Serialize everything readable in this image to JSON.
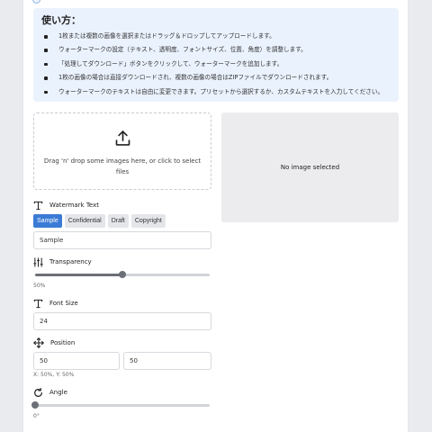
{
  "instructions": {
    "title": "使い方：",
    "items": [
      "1枚または複数の画像を選択またはドラッグ＆ドロップしてアップロードします。",
      "ウォーターマークの設定（テキスト、透明度、フォントサイズ、位置、角度）を調整します。",
      "「処理してダウンロード」ボタンをクリックして、ウォーターマークを追加します。",
      "1枚の画像の場合は直接ダウンロードされ、複数の画像の場合はZIPファイルでダウンロードされます。",
      "ウォーターマークのテキストは自由に変更できます。プリセットから選択するか、カスタムテキストを入力してください。"
    ]
  },
  "dropzone": {
    "text": "Drag 'n' drop some images here, or click to select files"
  },
  "preview": {
    "empty_text": "No image selected"
  },
  "watermark": {
    "label": "Watermark Text",
    "presets": [
      "Sample",
      "Confidential",
      "Draft",
      "Copyright"
    ],
    "active_preset": "Sample",
    "value": "Sample"
  },
  "transparency": {
    "label": "Transparency",
    "value": 0.5,
    "display": "50%"
  },
  "font_size": {
    "label": "Font Size",
    "value": "24"
  },
  "position": {
    "label": "Position",
    "x": "50",
    "y": "50",
    "display": "X: 50%, Y: 50%"
  },
  "angle": {
    "label": "Angle",
    "value": 0,
    "display": "0°"
  },
  "colors": {
    "accent": "#3a7bd5",
    "info_bg": "#eaf2fd",
    "preview_bg": "#ececee"
  }
}
